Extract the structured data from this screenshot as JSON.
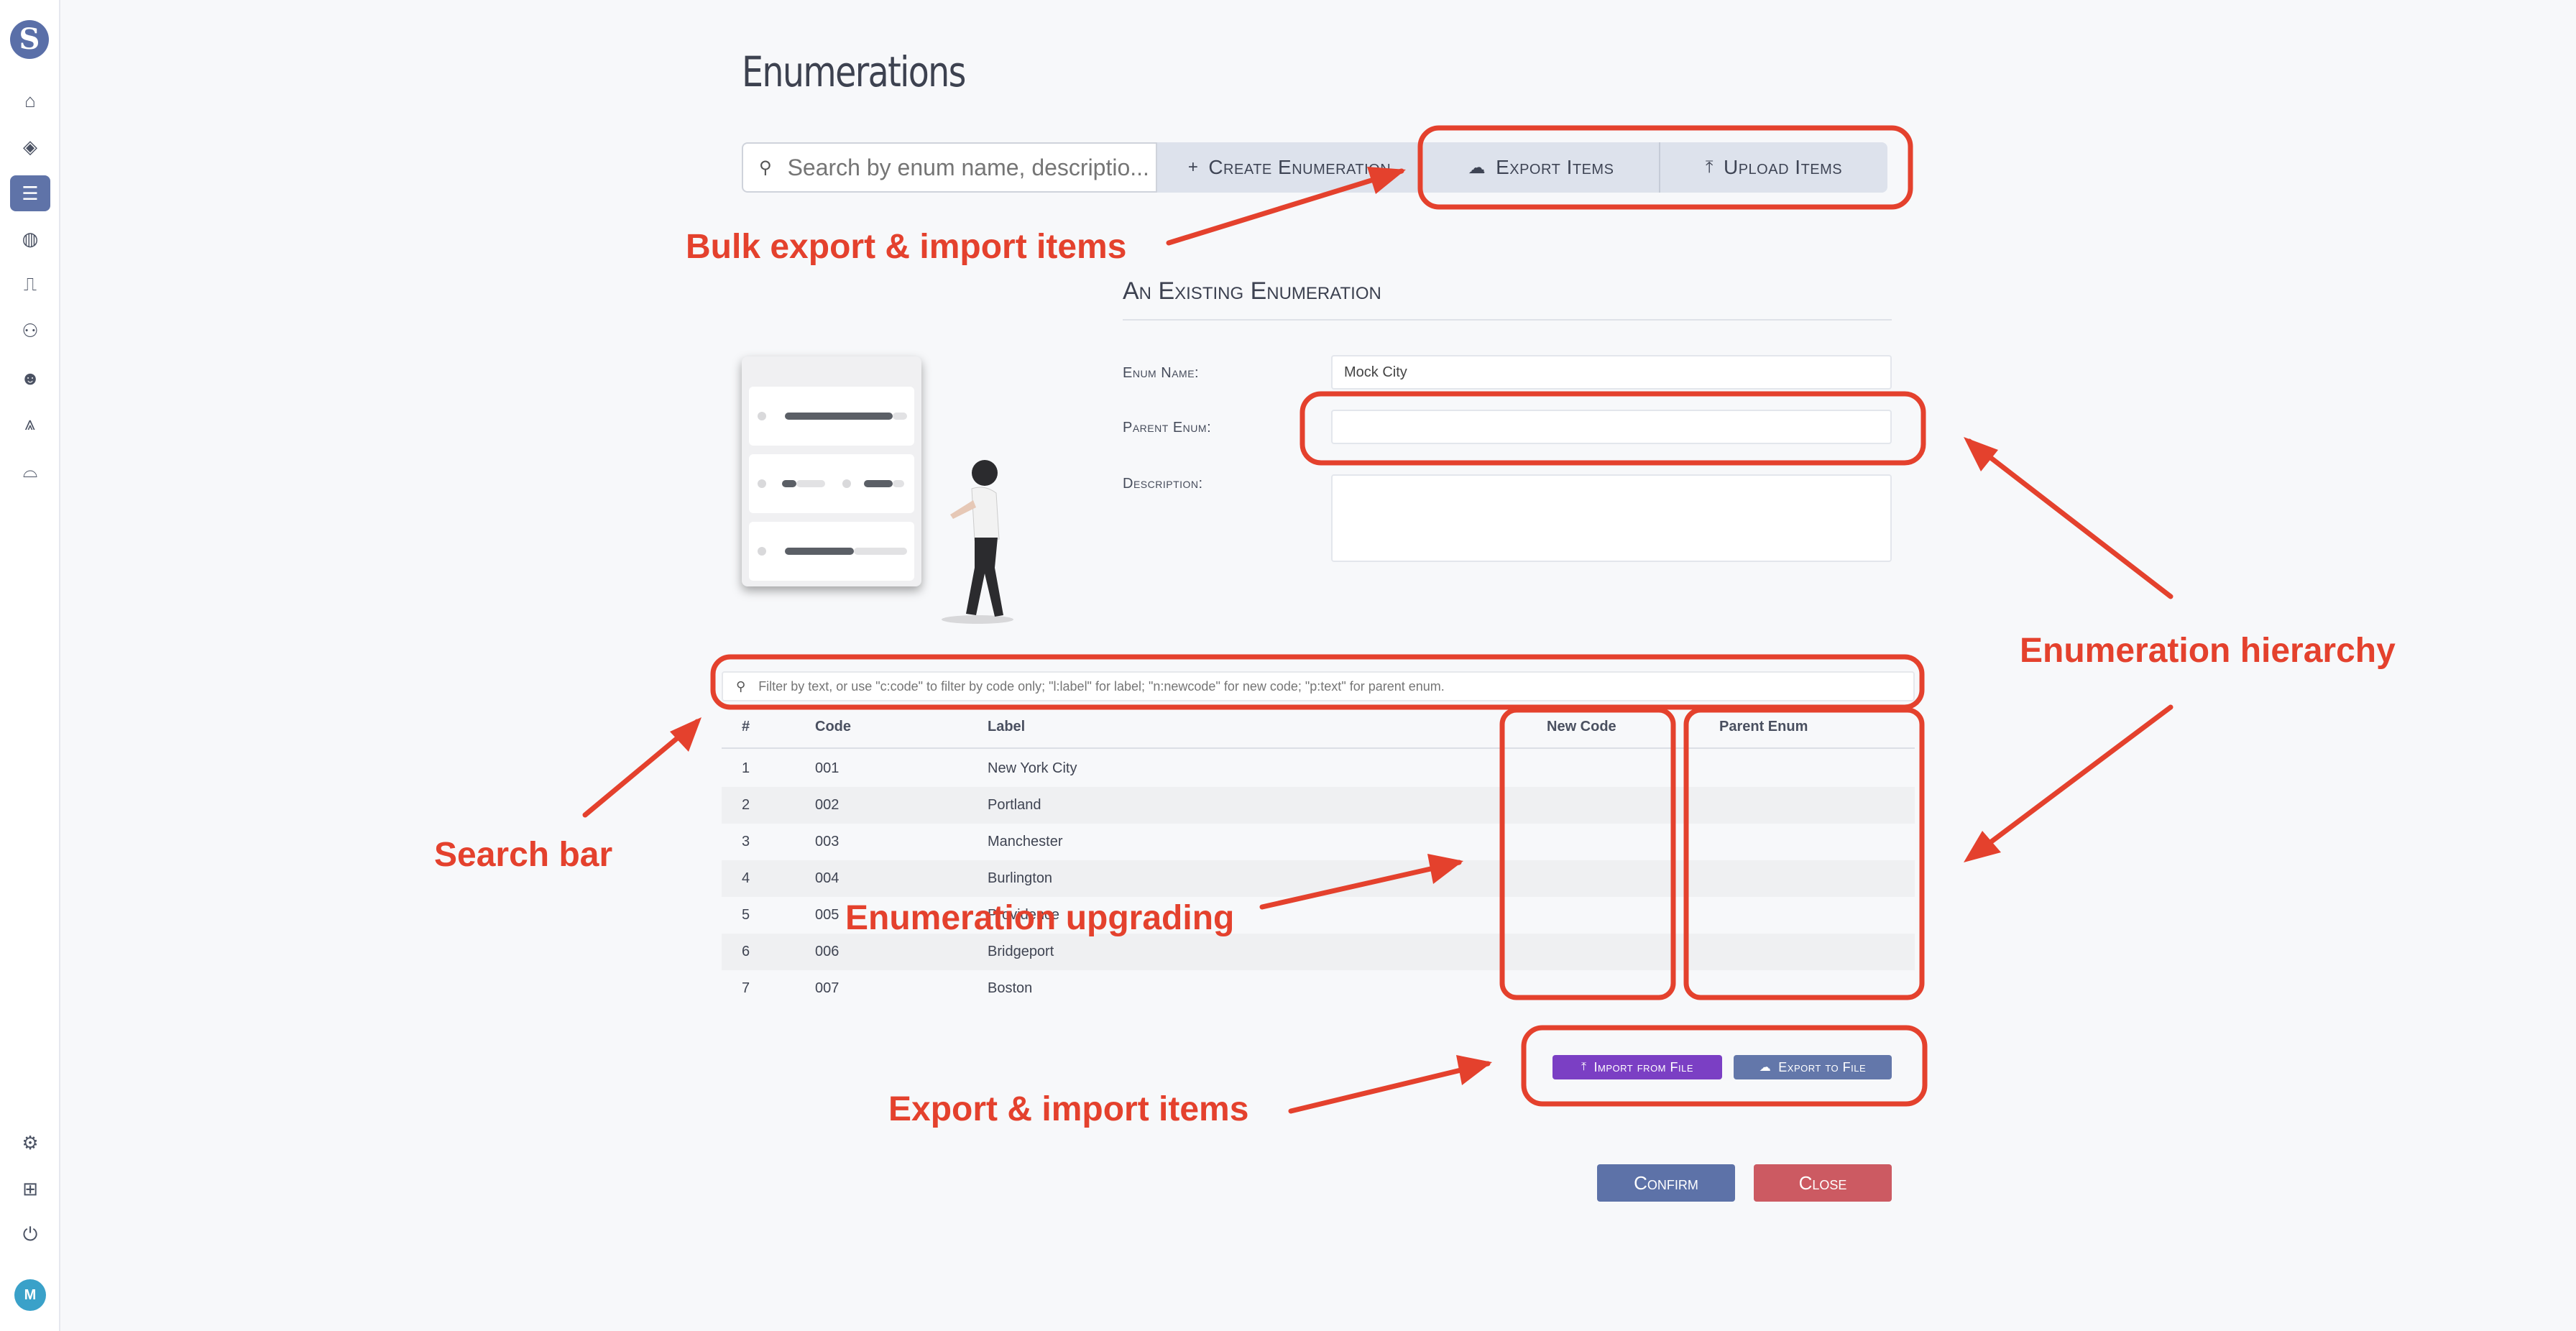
{
  "page": {
    "title": "Enumerations"
  },
  "sidebar": {
    "logo": "S",
    "avatar_initials": "M",
    "items": [
      {
        "icon": "home-icon",
        "glyph": "⌂"
      },
      {
        "icon": "tags-icon",
        "glyph": "◈"
      },
      {
        "icon": "list-icon",
        "glyph": "☰",
        "active": true
      },
      {
        "icon": "globe-icon",
        "glyph": "◍"
      },
      {
        "icon": "signal-icon",
        "glyph": "⎍"
      },
      {
        "icon": "users-icon",
        "glyph": "⚇"
      },
      {
        "icon": "user-icon",
        "glyph": "☻"
      },
      {
        "icon": "drafting-icon",
        "glyph": "⩓"
      },
      {
        "icon": "archway-icon",
        "glyph": "⌓"
      }
    ],
    "bottom_items": [
      {
        "icon": "gear-icon",
        "glyph": "⚙"
      },
      {
        "icon": "network-icon",
        "glyph": "⊞"
      },
      {
        "icon": "power-icon",
        "glyph": "⏻"
      }
    ]
  },
  "toolbar": {
    "search_placeholder": "Search by enum name, descriptio...",
    "create_label": "Create Enumeration",
    "export_label": "Export Items",
    "upload_label": "Upload Items"
  },
  "form": {
    "section_title": "An Existing Enumeration",
    "enum_name_label": "Enum Name:",
    "enum_name_value": "Mock City",
    "parent_enum_label": "Parent Enum:",
    "parent_enum_value": "",
    "description_label": "Description:",
    "description_value": ""
  },
  "table": {
    "filter_placeholder": "Filter by text, or use \"c:code\" to filter by code only; \"l:label\" for label; \"n:newcode\" for new code; \"p:text\" for parent enum.",
    "columns": [
      "#",
      "Code",
      "Label",
      "New Code",
      "Parent Enum"
    ],
    "rows": [
      {
        "num": "1",
        "code": "001",
        "label": "New York City",
        "new_code": "",
        "parent": ""
      },
      {
        "num": "2",
        "code": "002",
        "label": "Portland",
        "new_code": "",
        "parent": ""
      },
      {
        "num": "3",
        "code": "003",
        "label": "Manchester",
        "new_code": "",
        "parent": ""
      },
      {
        "num": "4",
        "code": "004",
        "label": "Burlington",
        "new_code": "",
        "parent": ""
      },
      {
        "num": "5",
        "code": "005",
        "label": "Providence",
        "new_code": "",
        "parent": ""
      },
      {
        "num": "6",
        "code": "006",
        "label": "Bridgeport",
        "new_code": "",
        "parent": ""
      },
      {
        "num": "7",
        "code": "007",
        "label": "Boston",
        "new_code": "",
        "parent": ""
      }
    ]
  },
  "actions": {
    "import_label": "Import from File",
    "export_label": "Export to File",
    "confirm_label": "Confirm",
    "close_label": "Close"
  },
  "annotations": {
    "bulk": "Bulk export & import items",
    "hierarchy": "Enumeration hierarchy",
    "search": "Search bar",
    "upgrading": "Enumeration upgrading",
    "export_import": "Export & import items",
    "color": "#e4412d"
  }
}
